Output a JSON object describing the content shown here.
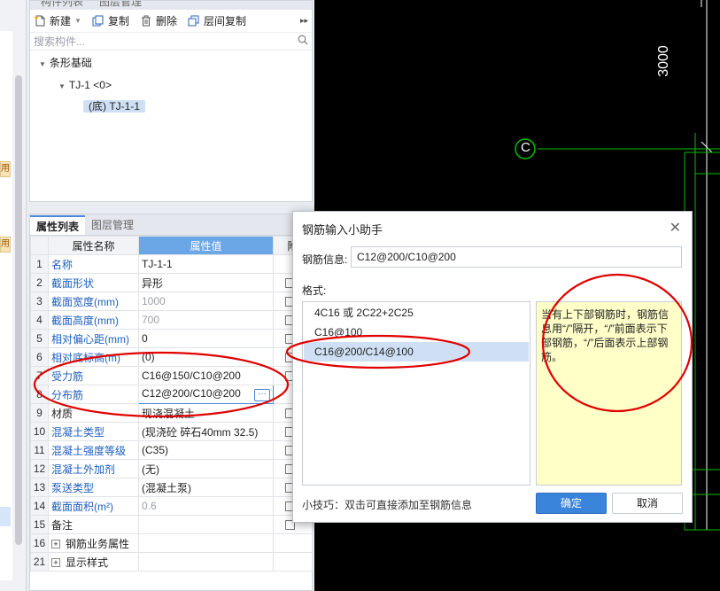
{
  "component_panel": {
    "tab_list": "构件列表",
    "tab_layer": "图层管理",
    "toolbar": {
      "new_label": "新建",
      "copy_label": "复制",
      "delete_label": "删除",
      "floor_copy_label": "层间复制"
    },
    "search_placeholder": "搜索构件...",
    "tree": {
      "root": "条形基础",
      "child": "TJ-1 <0>",
      "leaf": "(底) TJ-1-1"
    }
  },
  "left_strip": {
    "use_tag": "用"
  },
  "property_panel": {
    "tab_props": "属性列表",
    "tab_layers": "图层管理",
    "columns": {
      "name": "属性名称",
      "value": "属性值",
      "extra": "附"
    },
    "rows": [
      {
        "num": "1",
        "name": "名称",
        "value": "TJ-1-1",
        "checkbox": false
      },
      {
        "num": "2",
        "name": "截面形状",
        "value": "异形",
        "checkbox": true
      },
      {
        "num": "3",
        "name": "截面宽度(mm)",
        "value": "1000",
        "checkbox": true
      },
      {
        "num": "4",
        "name": "截面高度(mm)",
        "value": "700",
        "checkbox": true
      },
      {
        "num": "5",
        "name": "相对偏心距(mm)",
        "value": "0",
        "checkbox": true
      },
      {
        "num": "6",
        "name": "相对底标高(m)",
        "value": "(0)",
        "checkbox": true
      },
      {
        "num": "7",
        "name": "受力筋",
        "value": "C16@150/C10@200",
        "checkbox": true
      },
      {
        "num": "8",
        "name": "分布筋",
        "value": "C12@200/C10@200",
        "checkbox": false
      },
      {
        "num": "9",
        "name": "材质",
        "value": "现浇混凝土",
        "checkbox": true
      },
      {
        "num": "10",
        "name": "混凝土类型",
        "value": "(现浇砼 碎石40mm 32.5)",
        "checkbox": true
      },
      {
        "num": "11",
        "name": "混凝土强度等级",
        "value": "(C35)",
        "checkbox": true
      },
      {
        "num": "12",
        "name": "混凝土外加剂",
        "value": "(无)",
        "checkbox": true
      },
      {
        "num": "13",
        "name": "泵送类型",
        "value": "(混凝土泵)",
        "checkbox": true
      },
      {
        "num": "14",
        "name": "截面面积(m²)",
        "value": "0.6",
        "checkbox": true
      },
      {
        "num": "15",
        "name": "备注",
        "value": "",
        "checkbox": true
      },
      {
        "num": "16",
        "name": "钢筋业务属性",
        "value": "",
        "checkbox": false
      },
      {
        "num": "21",
        "name": "显示样式",
        "value": "",
        "checkbox": false
      }
    ]
  },
  "cad": {
    "dimension_text": "3000",
    "axis_label": "C"
  },
  "dialog": {
    "title": "钢筋输入小助手",
    "info_label": "钢筋信息:",
    "info_value": "C12@200/C10@200",
    "format_label": "格式:",
    "formats": [
      "4C16 或 2C22+2C25",
      "C16@100",
      "C16@200/C14@100"
    ],
    "tip": "当有上下部钢筋时，钢筋信息用“/”隔开，“/”前面表示下部钢筋，“/”后面表示上部钢筋。",
    "hint": "小技巧：双击可直接添加至钢筋信息",
    "ok_label": "确定",
    "cancel_label": "取消"
  },
  "colors": {
    "accent": "#3a84dc",
    "annotation_red": "#e00000",
    "cad_green": "#00c000",
    "tip_bg": "#ffffc8"
  }
}
